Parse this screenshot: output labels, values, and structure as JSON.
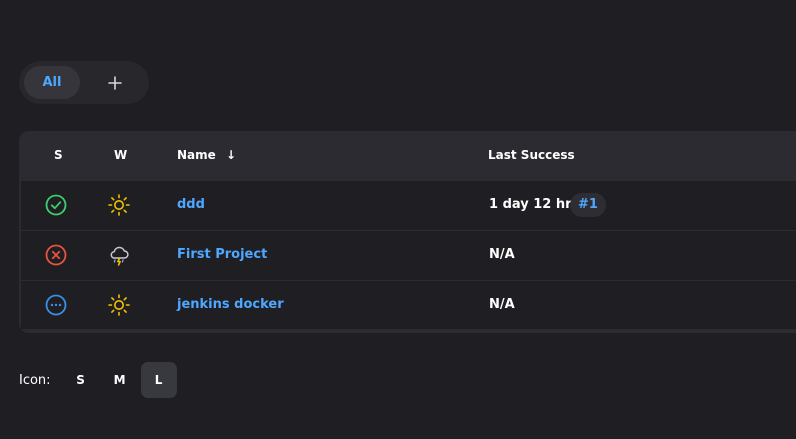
{
  "tabs": {
    "all_label": "All",
    "add_label": "+"
  },
  "table": {
    "headers": {
      "status": "S",
      "weather": "W",
      "name": "Name",
      "name_sort_indicator": "↓",
      "last_success": "Last Success"
    },
    "rows": [
      {
        "status": "success",
        "weather": "sunny",
        "name": "ddd",
        "last_success": "1 day 12 hr",
        "build": "#1"
      },
      {
        "status": "failed",
        "weather": "thunderstorm",
        "name": "First Project",
        "last_success": "N/A"
      },
      {
        "status": "not-built",
        "weather": "sunny",
        "name": "jenkins docker",
        "last_success": "N/A"
      }
    ]
  },
  "icon_size": {
    "label": "Icon:",
    "options": [
      "S",
      "M",
      "L"
    ],
    "selected": "L"
  },
  "colors": {
    "accent": "#4ea8ff",
    "success": "#3ccf6e",
    "failure": "#e8533f",
    "not_built": "#3a8fe8",
    "sun": "#f2c200"
  }
}
